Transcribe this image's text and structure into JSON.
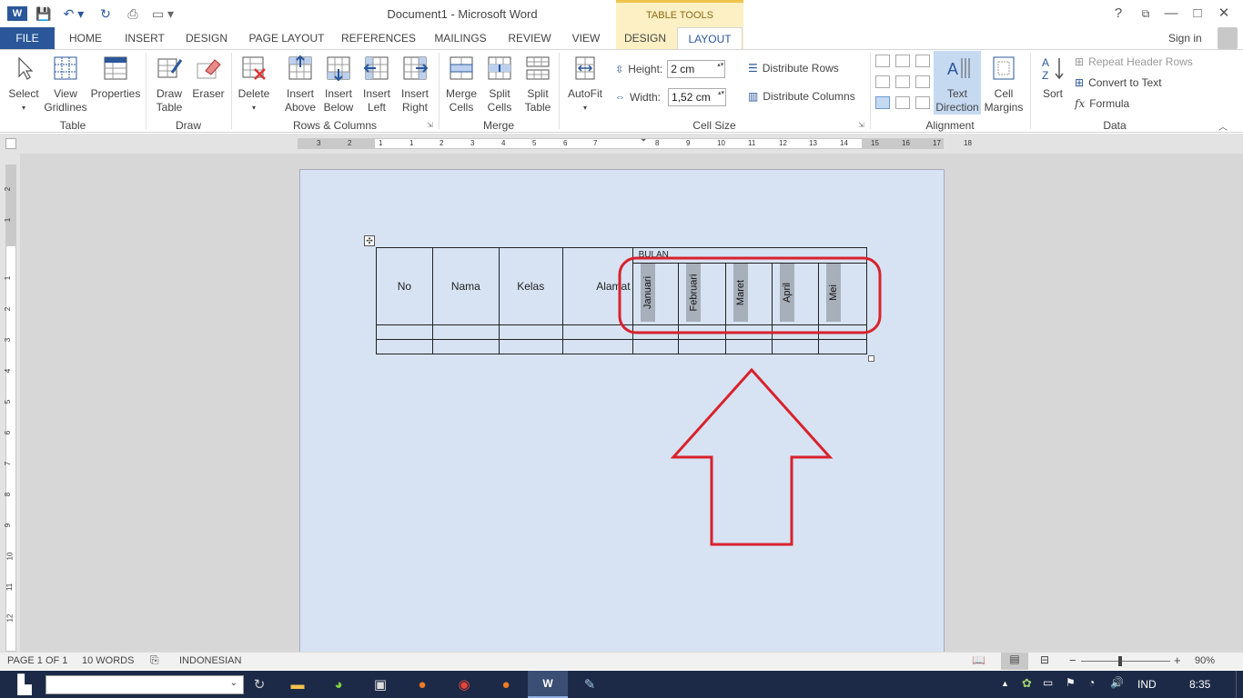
{
  "window": {
    "title": "Document1 - Microsoft Word",
    "contextual_tab_group": "TABLE TOOLS",
    "sign_in": "Sign in",
    "help": "?"
  },
  "tabs": [
    "FILE",
    "HOME",
    "INSERT",
    "DESIGN",
    "PAGE LAYOUT",
    "REFERENCES",
    "MAILINGS",
    "REVIEW",
    "VIEW",
    "DESIGN",
    "LAYOUT"
  ],
  "ribbon": {
    "table_group": {
      "select": "Select",
      "view_gridlines": [
        "View",
        "Gridlines"
      ],
      "properties": "Properties",
      "label": "Table"
    },
    "draw_group": {
      "draw_table": [
        "Draw",
        "Table"
      ],
      "eraser": "Eraser",
      "label": "Draw"
    },
    "rows_cols_group": {
      "delete": "Delete",
      "insert_above": [
        "Insert",
        "Above"
      ],
      "insert_below": [
        "Insert",
        "Below"
      ],
      "insert_left": [
        "Insert",
        "Left"
      ],
      "insert_right": [
        "Insert",
        "Right"
      ],
      "label": "Rows & Columns"
    },
    "merge_group": {
      "merge_cells": [
        "Merge",
        "Cells"
      ],
      "split_cells": [
        "Split",
        "Cells"
      ],
      "split_table": [
        "Split",
        "Table"
      ],
      "label": "Merge"
    },
    "cell_size_group": {
      "autofit": "AutoFit",
      "height_label": "Height:",
      "height_value": "2 cm",
      "width_label": "Width:",
      "width_value": "1,52 cm",
      "distribute_rows": "Distribute Rows",
      "distribute_columns": "Distribute Columns",
      "label": "Cell Size"
    },
    "alignment_group": {
      "text_direction": [
        "Text",
        "Direction"
      ],
      "cell_margins": [
        "Cell",
        "Margins"
      ],
      "label": "Alignment"
    },
    "data_group": {
      "sort": "Sort",
      "repeat_header_rows": "Repeat Header Rows",
      "convert_to_text": "Convert to Text",
      "formula": "Formula",
      "label": "Data"
    }
  },
  "ruler_h_numbers": [
    "3",
    "2",
    "1",
    "1",
    "2",
    "3",
    "4",
    "5",
    "6",
    "7",
    "8",
    "9",
    "10",
    "11",
    "12",
    "13",
    "14",
    "15",
    "16",
    "17",
    "18"
  ],
  "ruler_v_numbers": [
    "2",
    "1",
    "1",
    "2",
    "3",
    "4",
    "5",
    "6",
    "7",
    "8",
    "9",
    "10",
    "11",
    "12"
  ],
  "table": {
    "header": [
      "No",
      "Nama",
      "Kelas",
      "Alamat"
    ],
    "group_header": "BULAN",
    "months": [
      "Januari",
      "Februari",
      "Maret",
      "April",
      "Mei"
    ]
  },
  "status": {
    "page": "PAGE 1 OF 1",
    "words": "10 WORDS",
    "language": "INDONESIAN",
    "zoom": "90%"
  },
  "taskbar": {
    "lang": "IND",
    "time": "8:35"
  },
  "colors": {
    "accent": "#2b579a",
    "annotation": "#d8222d",
    "page_bg": "#d7e3f3",
    "context_tab": "#fdf0c4"
  }
}
